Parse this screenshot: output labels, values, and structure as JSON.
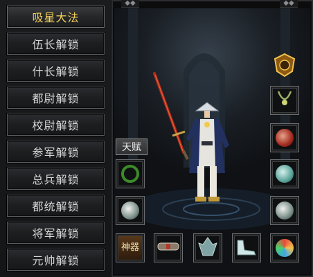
{
  "menu": {
    "items": [
      {
        "label": "吸星大法",
        "active": true
      },
      {
        "label": "伍长解锁",
        "active": false
      },
      {
        "label": "什长解锁",
        "active": false
      },
      {
        "label": "都尉解锁",
        "active": false
      },
      {
        "label": "校尉解锁",
        "active": false
      },
      {
        "label": "参军解锁",
        "active": false
      },
      {
        "label": "总兵解锁",
        "active": false
      },
      {
        "label": "都统解锁",
        "active": false
      },
      {
        "label": "将军解锁",
        "active": false
      },
      {
        "label": "元帅解锁",
        "active": false
      }
    ]
  },
  "panel": {
    "talent_label": "天赋",
    "shenqi_badge": "神器",
    "colors": {
      "active_text": "#f3cf5c",
      "menu_text": "#d6d6d6",
      "slot_border": "#6c6e70"
    },
    "slots": [
      {
        "name": "emblem-icon"
      },
      {
        "name": "necklace-icon"
      },
      {
        "name": "red-amulet-icon"
      },
      {
        "name": "bracelet-left-icon"
      },
      {
        "name": "bracelet-right-icon"
      },
      {
        "name": "ring-left-icon"
      },
      {
        "name": "ring-right-icon"
      },
      {
        "name": "shenqi-icon"
      },
      {
        "name": "belt-icon"
      },
      {
        "name": "dragon-icon"
      },
      {
        "name": "boots-icon"
      },
      {
        "name": "medal-icon"
      }
    ]
  }
}
